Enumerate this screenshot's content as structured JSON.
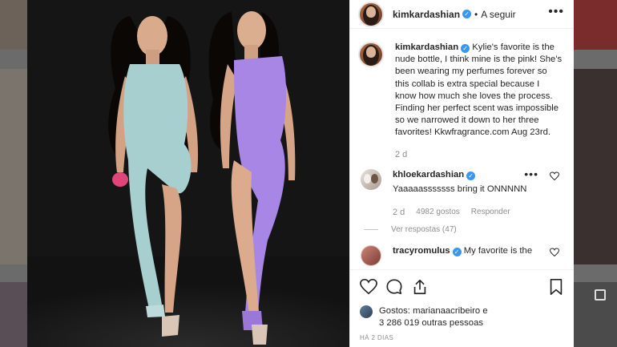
{
  "post": {
    "username": "kimkardashian",
    "follow_label": "A seguir",
    "more_label": "•••",
    "caption_user": "kimkardashian",
    "caption_text": " Kylie's favorite is the nude bottle, I think mine is the pink! She's been wearing my perfumes forever so this collab is extra special because I know how much she loves the process. Finding her perfect scent was impossible so we narrowed it down to her three favorites! Kkwfragrance.com Aug 23rd.",
    "caption_age": "2 d",
    "verified_glyph": "✓"
  },
  "comments": [
    {
      "user": "khloekardashian",
      "text": "Yaaaaasssssss bring it ONNNNN",
      "age": "2 d",
      "likes": "4982 gostos",
      "reply_label": "Responder",
      "view_replies": "Ver respostas (47)"
    },
    {
      "user": "tracyromulus",
      "text": "My favorite is the"
    }
  ],
  "footer": {
    "likes_prefix": "Gostos: ",
    "likes_user": "marianaacribeiro",
    "likes_suffix": " e",
    "likes_others": "3 286 019 outras pessoas",
    "time_ago": "HÁ 2 DIAS"
  },
  "icons": {
    "like": "heart-icon",
    "comment": "comment-icon",
    "share": "share-icon",
    "save": "bookmark-icon",
    "verified_color": "#3897f0"
  }
}
